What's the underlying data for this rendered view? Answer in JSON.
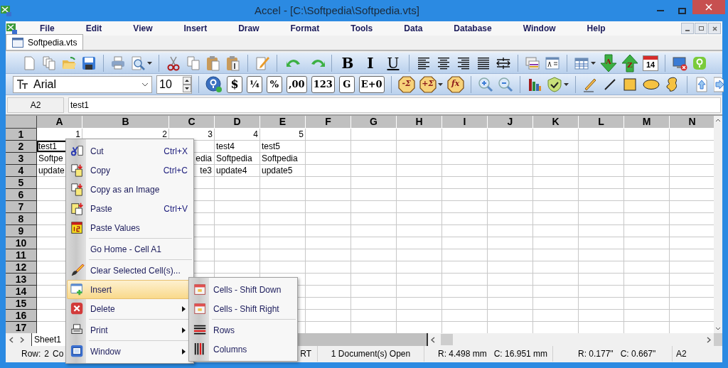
{
  "window": {
    "title": "Accel - [C:\\Softpedia\\Softpedia.vts]"
  },
  "menu_bar": [
    "File",
    "Edit",
    "View",
    "Insert",
    "Draw",
    "Format",
    "Tools",
    "Data",
    "Database",
    "Window",
    "Help"
  ],
  "document_tabs": [
    {
      "label": "Softpedia.vts",
      "selected": true
    }
  ],
  "toolbar_1": {
    "bold": "B",
    "italic": "I",
    "underline": "U",
    "sort_ascending": "A",
    "sort_descending": "Z",
    "calendar_day": "14"
  },
  "toolbar_2": {
    "font": "Arial",
    "font_size": "10",
    "currency": "$",
    "fraction": "¼",
    "percent": "%",
    "decimal": ",00",
    "number_format": "123",
    "general": "G",
    "scientific": "E+0",
    "remove_sum": "-Σ",
    "add_sum": "+Σ",
    "function": "fx"
  },
  "formula_bar": {
    "cell": "A2",
    "value": "test1"
  },
  "grid": {
    "columns": [
      "A",
      "B",
      "C",
      "D",
      "E",
      "F",
      "G",
      "H",
      "I",
      "J",
      "K",
      "L",
      "M",
      "N"
    ],
    "rows": [
      {
        "header": "1",
        "cells": {
          "A": {
            "text": "1",
            "kind": "number",
            "selected": false
          },
          "B": {
            "text": "2",
            "kind": "number",
            "selected": false
          },
          "C": {
            "text": "3",
            "kind": "number",
            "selected": false
          },
          "D": {
            "text": "4",
            "kind": "number",
            "selected": false
          },
          "E": {
            "text": "5",
            "kind": "number",
            "selected": false
          }
        }
      },
      {
        "header": "2",
        "cells": {
          "A": {
            "text": "test1",
            "kind": "text",
            "selected": true
          },
          "D": {
            "text": "test4",
            "kind": "text",
            "selected": false
          },
          "E": {
            "text": "test5",
            "kind": "text",
            "selected": false
          }
        }
      },
      {
        "header": "3",
        "cells": {
          "A": {
            "text": "Softpe",
            "kind": "text",
            "selected": false
          },
          "C": {
            "text": "edia",
            "kind": "partial",
            "selected": false
          },
          "D": {
            "text": "Softpedia",
            "kind": "text",
            "selected": false
          },
          "E": {
            "text": "Softpedia",
            "kind": "text",
            "selected": false
          }
        }
      },
      {
        "header": "4",
        "cells": {
          "A": {
            "text": "update",
            "kind": "text",
            "selected": false
          },
          "C": {
            "text": "te3",
            "kind": "partial",
            "selected": false
          },
          "D": {
            "text": "update4",
            "kind": "text",
            "selected": false
          },
          "E": {
            "text": "update5",
            "kind": "text",
            "selected": false
          }
        }
      },
      {
        "header": "5",
        "cells": {}
      },
      {
        "header": "6",
        "cells": {}
      },
      {
        "header": "7",
        "cells": {}
      },
      {
        "header": "8",
        "cells": {}
      },
      {
        "header": "9",
        "cells": {}
      },
      {
        "header": "10",
        "cells": {}
      },
      {
        "header": "11",
        "cells": {}
      },
      {
        "header": "12",
        "cells": {}
      },
      {
        "header": "13",
        "cells": {}
      },
      {
        "header": "14",
        "cells": {}
      },
      {
        "header": "15",
        "cells": {}
      },
      {
        "header": "16",
        "cells": {}
      },
      {
        "header": "17",
        "cells": {}
      }
    ]
  },
  "sheet_tabs": [
    {
      "label": "Sheet1",
      "selected": true
    }
  ],
  "status_bar": {
    "row_label": "Row:",
    "row": "2",
    "column_label": "Co",
    "mode": "RT",
    "documents": "1 Document(s) Open",
    "row_mm": "R: 4.498 mm",
    "column_mm": "C: 16.951 mm",
    "row_inches": "R: 0.177\"",
    "column_inches": "C: 0.667\"",
    "cell": "A2"
  },
  "context_menu": [
    {
      "kind": "item",
      "label": "Cut",
      "shortcut": "Ctrl+X",
      "selected": false,
      "submenu": false
    },
    {
      "kind": "item",
      "label": "Copy",
      "shortcut": "Ctrl+C",
      "selected": false,
      "submenu": false
    },
    {
      "kind": "item",
      "label": "Copy as an Image",
      "selected": false,
      "submenu": false
    },
    {
      "kind": "item",
      "label": "Paste",
      "shortcut": "Ctrl+V",
      "selected": false,
      "submenu": false
    },
    {
      "kind": "item",
      "label": "Paste Values",
      "selected": false,
      "submenu": false
    },
    {
      "kind": "separator"
    },
    {
      "kind": "item",
      "label": "Go Home - Cell A1",
      "selected": false,
      "submenu": false
    },
    {
      "kind": "separator"
    },
    {
      "kind": "item",
      "label": "Clear Selected Cell(s)...",
      "selected": false,
      "submenu": false
    },
    {
      "kind": "item",
      "label": "Insert",
      "selected": true,
      "submenu": false
    },
    {
      "kind": "item",
      "label": "Delete",
      "selected": false,
      "submenu": true
    },
    {
      "kind": "separator"
    },
    {
      "kind": "item",
      "label": "Print",
      "selected": false,
      "submenu": true
    },
    {
      "kind": "separator"
    },
    {
      "kind": "item",
      "label": "Window",
      "selected": false,
      "submenu": true
    }
  ],
  "submenu": [
    {
      "kind": "item",
      "label": "Cells - Shift Down"
    },
    {
      "kind": "item",
      "label": "Cells - Shift Right"
    },
    {
      "kind": "separator"
    },
    {
      "kind": "item",
      "label": "Rows"
    },
    {
      "kind": "item",
      "label": "Columns"
    }
  ]
}
